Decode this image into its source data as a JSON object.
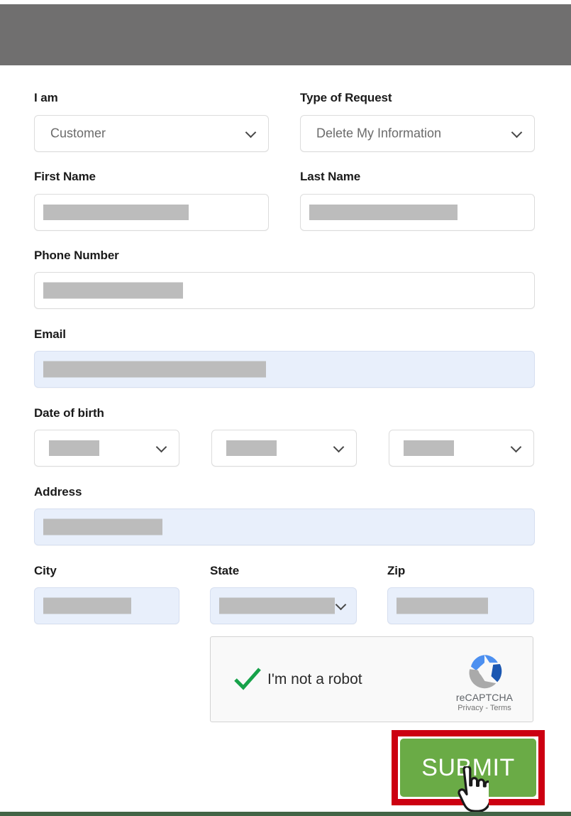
{
  "page": {
    "top_banner_color": "#706f6f",
    "footer_color": "#436446",
    "background": "#ffffff"
  },
  "form": {
    "fields": [
      {
        "label": "I am",
        "type": "select",
        "value": "Customer",
        "redacted": false
      },
      {
        "label": "Type of Request",
        "type": "select",
        "value": "Delete My Information",
        "redacted": false
      },
      {
        "label": "First Name",
        "type": "text",
        "value": "",
        "redacted": true
      },
      {
        "label": "Last Name",
        "type": "text",
        "value": "",
        "redacted": true
      },
      {
        "label": "Phone Number",
        "type": "text",
        "value": "",
        "redacted": true
      },
      {
        "label": "Email",
        "type": "text",
        "value": "",
        "redacted": true,
        "autofilled": true
      },
      {
        "label": "Date of birth",
        "type": "select-group",
        "value": "",
        "redacted": true
      },
      {
        "label": "Address",
        "type": "text",
        "value": "",
        "redacted": true,
        "autofilled": true
      },
      {
        "label": "City",
        "type": "text",
        "value": "",
        "redacted": true,
        "autofilled": true
      },
      {
        "label": "State",
        "type": "select",
        "value": "",
        "redacted": true,
        "autofilled": true
      },
      {
        "label": "Zip",
        "type": "text",
        "value": "",
        "redacted": true,
        "autofilled": true
      }
    ],
    "labels": {
      "i_am": "I am",
      "type_of_request": "Type of Request",
      "first_name": "First Name",
      "last_name": "Last Name",
      "phone_number": "Phone Number",
      "email": "Email",
      "date_of_birth": "Date of birth",
      "address": "Address",
      "city": "City",
      "state": "State",
      "zip": "Zip"
    },
    "values": {
      "i_am": "Customer",
      "type_of_request": "Delete My Information"
    },
    "autofill_color": "#e8effb",
    "redaction_color": "#bcbcbc"
  },
  "recaptcha": {
    "checkbox_label": "I'm not a robot",
    "brand": "reCAPTCHA",
    "links": "Privacy - Terms",
    "checked": true,
    "check_color": "#17a24a"
  },
  "submit": {
    "label": "SUBMIT",
    "button_color": "#6aab46",
    "highlight_color": "#cc0011"
  },
  "cursor": {
    "type": "pointer-hand-cursor"
  }
}
